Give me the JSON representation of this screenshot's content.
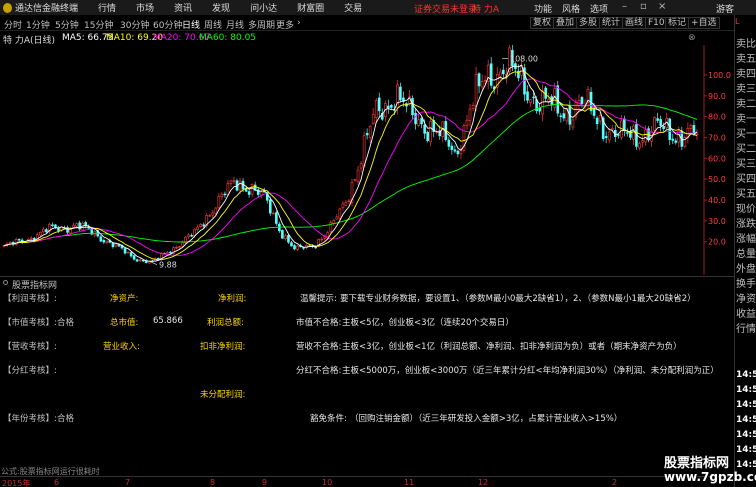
{
  "app": {
    "title": "通达信金融终端"
  },
  "menu": {
    "items": [
      "行情",
      "市场",
      "资讯",
      "发现",
      "问小达",
      "财富圈",
      "交易"
    ]
  },
  "notice": "证券交易未登录",
  "stock_name": "特 力A",
  "menu_right": [
    "功能",
    "风格",
    "选项"
  ],
  "guest": "游客",
  "periods": [
    "分时",
    "1分钟",
    "5分钟",
    "15分钟",
    "30分钟",
    "60分钟",
    "日线",
    "周线",
    "月线",
    "多周期",
    "更多"
  ],
  "active_period": "日线",
  "more_arrow": "›",
  "tools": [
    "复权",
    "叠加",
    "多股",
    "统计",
    "画线",
    "F10",
    "标记",
    "+自选"
  ],
  "ma_header": {
    "name": "特 力A(日线)",
    "ma5": "MA5: 66.75",
    "ma10": "MA10: 69.20",
    "ma20": "MA20: 70.67",
    "ma60": "MA60: 80.05",
    "close": "⊗"
  },
  "price_axis": [
    "100.0",
    "90.0",
    "80.0",
    "70.0",
    "60.0",
    "50.0",
    "40.0",
    "30.0",
    "20.0"
  ],
  "annotations": {
    "high": "108.00",
    "low": "9.88"
  },
  "colors": {
    "up": "#ff3c3c",
    "down": "#54ffff",
    "ma5": "#ffffff",
    "ma10": "#ffff00",
    "ma20": "#ff00ff",
    "ma60": "#00ff00"
  },
  "panel": {
    "title": "股票指标网",
    "rows": [
      {
        "tag": "【利润考核】:",
        "label1": "净资产:",
        "label2": "净利润:",
        "note_label": "温馨提示:",
        "note": "要下载专业财务数据，要设置1、（参数M最小0最大2缺省1），2、（参数N最小1最大20缺省2）"
      },
      {
        "tag": "【市值考核】:",
        "status": "合格",
        "label1": "总市值:",
        "value1": "65.866",
        "label2": "利润总额:",
        "note_label": "市值不合格:",
        "note": "主板<5亿，创业板<3亿（连续20个交易日）"
      },
      {
        "tag": "【营收考核】:",
        "label1": "营业收入:",
        "label2": "扣非净利润:",
        "note_label": "营收不合格:",
        "note": "主板<3亿，创业板<1亿（利润总额、净利润、扣非净利润为负）或者（期末净资产为负）"
      },
      {
        "tag": "【分红考核】:",
        "note_label": "分红不合格:",
        "note": "主板<5000万，创业板<3000万（近三年累计分红<年均净利润30%）（净利润、未分配利润为正）"
      },
      {
        "tag": "",
        "label2": "未分配利润:"
      },
      {
        "tag": "【年份考核】:",
        "status": "合格",
        "note_label": "豁免条件:",
        "note": "（回购注销金额）（近三年研发投入金额>3亿，占累计营业收入>15%）"
      }
    ]
  },
  "formula_bar": "公式:股票指标网运行很耗时",
  "time_axis": [
    "2015年",
    "6",
    "7",
    "8",
    "9",
    "10",
    "11",
    "12",
    "2"
  ],
  "right_panel": {
    "head": "L",
    "labels": [
      "卖比",
      "卖五",
      "卖四",
      "卖三",
      "卖二",
      "卖一",
      "买一",
      "买二",
      "买三",
      "买四",
      "买五",
      "现价",
      "涨跌",
      "涨幅",
      "总量",
      "外盘",
      "换手",
      "净资",
      "收益",
      "行情"
    ],
    "times": [
      "14:5",
      "14:5",
      "14:5",
      "14:5",
      "14:5",
      "14:5",
      "14:5"
    ]
  },
  "watermark": {
    "line1": "股票指标网",
    "line2": "www.7gpzb.com"
  }
}
